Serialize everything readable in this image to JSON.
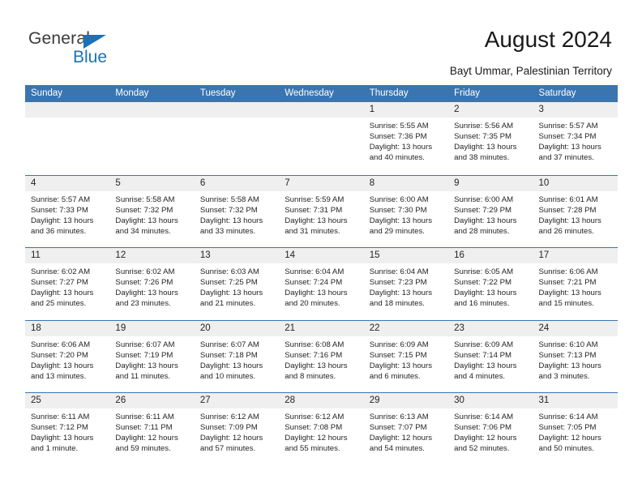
{
  "brand": {
    "name_top": "General",
    "name_bottom": "Blue",
    "accent_color": "#1b72b8"
  },
  "header": {
    "title": "August 2024",
    "subtitle": "Bayt Ummar, Palestinian Territory"
  },
  "calendar": {
    "header_color": "#3a75b0",
    "day_band_color": "#efefef",
    "weekday_names": [
      "Sunday",
      "Monday",
      "Tuesday",
      "Wednesday",
      "Thursday",
      "Friday",
      "Saturday"
    ],
    "weeks": [
      [
        {
          "date": "",
          "lines": []
        },
        {
          "date": "",
          "lines": []
        },
        {
          "date": "",
          "lines": []
        },
        {
          "date": "",
          "lines": []
        },
        {
          "date": "1",
          "lines": [
            "Sunrise: 5:55 AM",
            "Sunset: 7:36 PM",
            "Daylight: 13 hours",
            "and 40 minutes."
          ]
        },
        {
          "date": "2",
          "lines": [
            "Sunrise: 5:56 AM",
            "Sunset: 7:35 PM",
            "Daylight: 13 hours",
            "and 38 minutes."
          ]
        },
        {
          "date": "3",
          "lines": [
            "Sunrise: 5:57 AM",
            "Sunset: 7:34 PM",
            "Daylight: 13 hours",
            "and 37 minutes."
          ]
        }
      ],
      [
        {
          "date": "4",
          "lines": [
            "Sunrise: 5:57 AM",
            "Sunset: 7:33 PM",
            "Daylight: 13 hours",
            "and 36 minutes."
          ]
        },
        {
          "date": "5",
          "lines": [
            "Sunrise: 5:58 AM",
            "Sunset: 7:32 PM",
            "Daylight: 13 hours",
            "and 34 minutes."
          ]
        },
        {
          "date": "6",
          "lines": [
            "Sunrise: 5:58 AM",
            "Sunset: 7:32 PM",
            "Daylight: 13 hours",
            "and 33 minutes."
          ]
        },
        {
          "date": "7",
          "lines": [
            "Sunrise: 5:59 AM",
            "Sunset: 7:31 PM",
            "Daylight: 13 hours",
            "and 31 minutes."
          ]
        },
        {
          "date": "8",
          "lines": [
            "Sunrise: 6:00 AM",
            "Sunset: 7:30 PM",
            "Daylight: 13 hours",
            "and 29 minutes."
          ]
        },
        {
          "date": "9",
          "lines": [
            "Sunrise: 6:00 AM",
            "Sunset: 7:29 PM",
            "Daylight: 13 hours",
            "and 28 minutes."
          ]
        },
        {
          "date": "10",
          "lines": [
            "Sunrise: 6:01 AM",
            "Sunset: 7:28 PM",
            "Daylight: 13 hours",
            "and 26 minutes."
          ]
        }
      ],
      [
        {
          "date": "11",
          "lines": [
            "Sunrise: 6:02 AM",
            "Sunset: 7:27 PM",
            "Daylight: 13 hours",
            "and 25 minutes."
          ]
        },
        {
          "date": "12",
          "lines": [
            "Sunrise: 6:02 AM",
            "Sunset: 7:26 PM",
            "Daylight: 13 hours",
            "and 23 minutes."
          ]
        },
        {
          "date": "13",
          "lines": [
            "Sunrise: 6:03 AM",
            "Sunset: 7:25 PM",
            "Daylight: 13 hours",
            "and 21 minutes."
          ]
        },
        {
          "date": "14",
          "lines": [
            "Sunrise: 6:04 AM",
            "Sunset: 7:24 PM",
            "Daylight: 13 hours",
            "and 20 minutes."
          ]
        },
        {
          "date": "15",
          "lines": [
            "Sunrise: 6:04 AM",
            "Sunset: 7:23 PM",
            "Daylight: 13 hours",
            "and 18 minutes."
          ]
        },
        {
          "date": "16",
          "lines": [
            "Sunrise: 6:05 AM",
            "Sunset: 7:22 PM",
            "Daylight: 13 hours",
            "and 16 minutes."
          ]
        },
        {
          "date": "17",
          "lines": [
            "Sunrise: 6:06 AM",
            "Sunset: 7:21 PM",
            "Daylight: 13 hours",
            "and 15 minutes."
          ]
        }
      ],
      [
        {
          "date": "18",
          "lines": [
            "Sunrise: 6:06 AM",
            "Sunset: 7:20 PM",
            "Daylight: 13 hours",
            "and 13 minutes."
          ]
        },
        {
          "date": "19",
          "lines": [
            "Sunrise: 6:07 AM",
            "Sunset: 7:19 PM",
            "Daylight: 13 hours",
            "and 11 minutes."
          ]
        },
        {
          "date": "20",
          "lines": [
            "Sunrise: 6:07 AM",
            "Sunset: 7:18 PM",
            "Daylight: 13 hours",
            "and 10 minutes."
          ]
        },
        {
          "date": "21",
          "lines": [
            "Sunrise: 6:08 AM",
            "Sunset: 7:16 PM",
            "Daylight: 13 hours",
            "and 8 minutes."
          ]
        },
        {
          "date": "22",
          "lines": [
            "Sunrise: 6:09 AM",
            "Sunset: 7:15 PM",
            "Daylight: 13 hours",
            "and 6 minutes."
          ]
        },
        {
          "date": "23",
          "lines": [
            "Sunrise: 6:09 AM",
            "Sunset: 7:14 PM",
            "Daylight: 13 hours",
            "and 4 minutes."
          ]
        },
        {
          "date": "24",
          "lines": [
            "Sunrise: 6:10 AM",
            "Sunset: 7:13 PM",
            "Daylight: 13 hours",
            "and 3 minutes."
          ]
        }
      ],
      [
        {
          "date": "25",
          "lines": [
            "Sunrise: 6:11 AM",
            "Sunset: 7:12 PM",
            "Daylight: 13 hours",
            "and 1 minute."
          ]
        },
        {
          "date": "26",
          "lines": [
            "Sunrise: 6:11 AM",
            "Sunset: 7:11 PM",
            "Daylight: 12 hours",
            "and 59 minutes."
          ]
        },
        {
          "date": "27",
          "lines": [
            "Sunrise: 6:12 AM",
            "Sunset: 7:09 PM",
            "Daylight: 12 hours",
            "and 57 minutes."
          ]
        },
        {
          "date": "28",
          "lines": [
            "Sunrise: 6:12 AM",
            "Sunset: 7:08 PM",
            "Daylight: 12 hours",
            "and 55 minutes."
          ]
        },
        {
          "date": "29",
          "lines": [
            "Sunrise: 6:13 AM",
            "Sunset: 7:07 PM",
            "Daylight: 12 hours",
            "and 54 minutes."
          ]
        },
        {
          "date": "30",
          "lines": [
            "Sunrise: 6:14 AM",
            "Sunset: 7:06 PM",
            "Daylight: 12 hours",
            "and 52 minutes."
          ]
        },
        {
          "date": "31",
          "lines": [
            "Sunrise: 6:14 AM",
            "Sunset: 7:05 PM",
            "Daylight: 12 hours",
            "and 50 minutes."
          ]
        }
      ]
    ]
  }
}
